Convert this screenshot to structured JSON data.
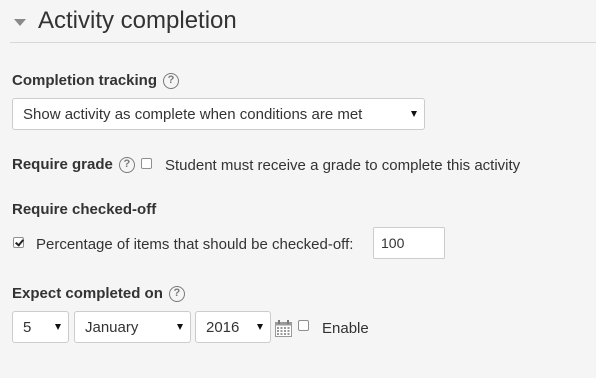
{
  "section": {
    "title": "Activity completion"
  },
  "completion_tracking": {
    "label": "Completion tracking",
    "help_glyph": "?",
    "selected": "Show activity as complete when conditions are met"
  },
  "require_grade": {
    "label": "Require grade",
    "help_glyph": "?",
    "checked": false,
    "checkbox_text": "Student must receive a grade to complete this activity"
  },
  "require_checked_off": {
    "label": "Require checked-off",
    "checked": true,
    "checkbox_text": "Percentage of items that should be checked-off:",
    "value": "100"
  },
  "expect_completed_on": {
    "label": "Expect completed on",
    "help_glyph": "?",
    "day": "5",
    "month": "January",
    "year": "2016",
    "enable_checked": false,
    "enable_label": "Enable"
  },
  "icons": {
    "collapse": "chevron-down-icon",
    "help": "help-icon",
    "calendar": "calendar-icon"
  },
  "colors": {
    "background": "#f5f5f5",
    "text": "#333333",
    "border": "#cccccc"
  }
}
